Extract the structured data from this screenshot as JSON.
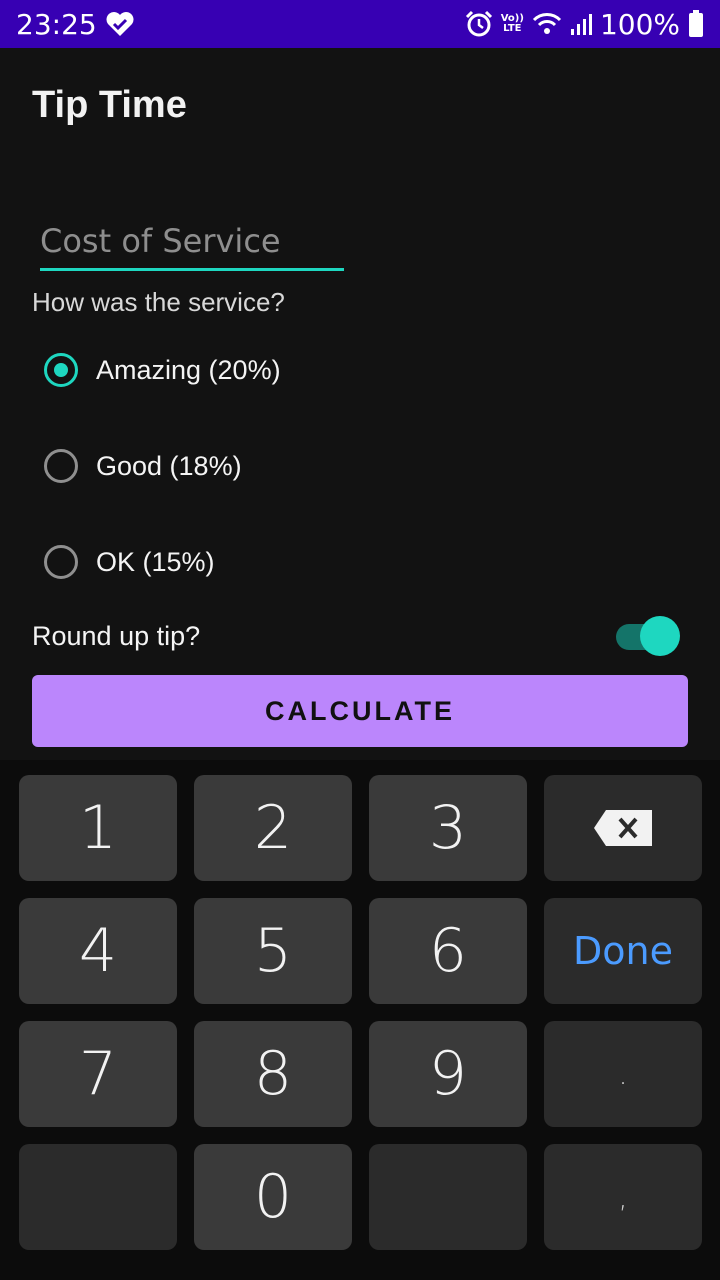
{
  "status_bar": {
    "time": "23:25",
    "battery": "100%",
    "volte_top": "Vo))",
    "volte_bottom": "LTE",
    "icons": [
      "heart-check-icon",
      "alarm-icon",
      "volte-icon",
      "wifi-icon",
      "signal-icon",
      "battery-icon"
    ]
  },
  "app": {
    "title": "Tip Time"
  },
  "form": {
    "cost_placeholder": "Cost of Service",
    "cost_value": "",
    "question": "How was the service?",
    "options": [
      {
        "label": "Amazing (20%)",
        "checked": true
      },
      {
        "label": "Good (18%)",
        "checked": false
      },
      {
        "label": "OK (15%)",
        "checked": false
      }
    ],
    "round_up_label": "Round up tip?",
    "round_up_on": true,
    "calculate_label": "CALCULATE"
  },
  "keyboard": {
    "keys": {
      "k1": "1",
      "k2": "2",
      "k3": "3",
      "k4": "4",
      "k5": "5",
      "k6": "6",
      "k7": "7",
      "k8": "8",
      "k9": "9",
      "k0": "0",
      "done": "Done",
      "dot": ".",
      "comma": ","
    }
  },
  "colors": {
    "status_bar": "#3700b3",
    "accent": "#1ed7c0",
    "button": "#bb86fc",
    "background": "#121212",
    "done_text": "#4b9bff"
  }
}
